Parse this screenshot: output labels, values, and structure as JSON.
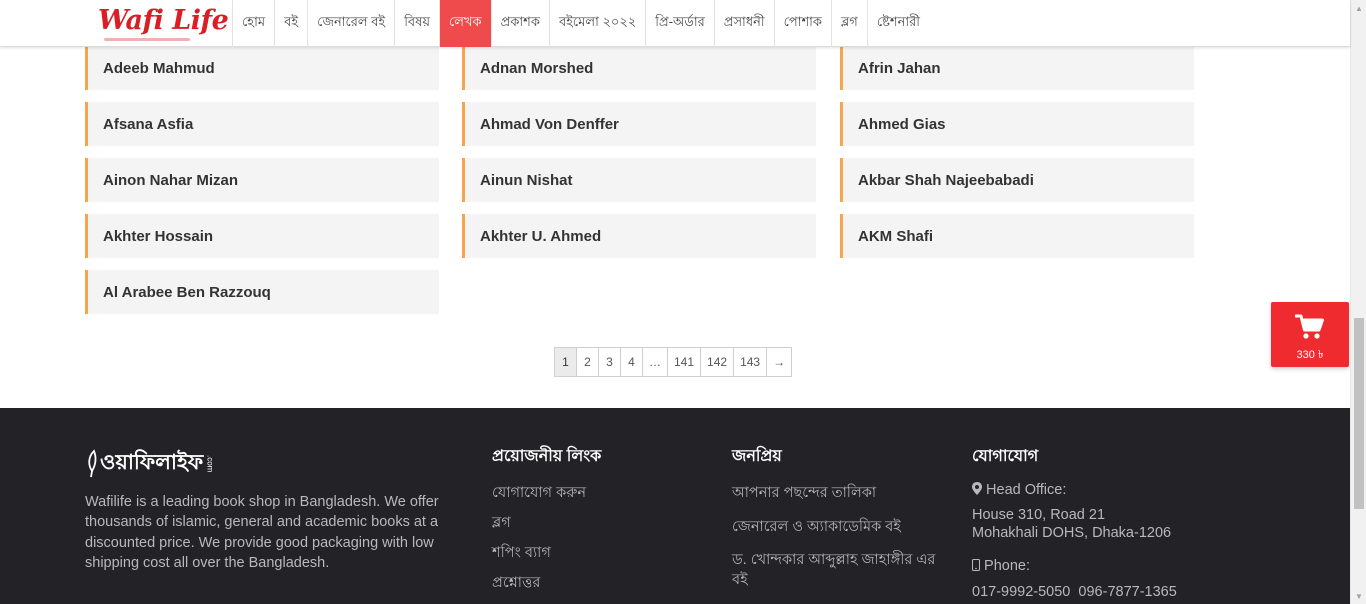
{
  "header": {
    "logo": "Wafi Life",
    "nav": [
      {
        "label": "হোম"
      },
      {
        "label": "বই"
      },
      {
        "label": "জেনারেল বই"
      },
      {
        "label": "বিষয়"
      },
      {
        "label": "লেখক",
        "active": true
      },
      {
        "label": "প্রকাশক"
      },
      {
        "label": "বইমেলা ২০২২"
      },
      {
        "label": "প্রি-অর্ডার"
      },
      {
        "label": "প্রসাধনী"
      },
      {
        "label": "পোশাক"
      },
      {
        "label": "ব্লগ"
      },
      {
        "label": "ষ্টেশনারী"
      }
    ]
  },
  "authors": [
    "Adeeb Mahmud",
    "Adnan Morshed",
    "Afrin Jahan",
    "Afsana Asfia",
    "Ahmad Von Denffer",
    "Ahmed Gias",
    "Ainon Nahar Mizan",
    "Ainun Nishat",
    "Akbar Shah Najeebabadi",
    "Akhter Hossain",
    "Akhter U. Ahmed",
    "AKM Shafi",
    "Al Arabee Ben Razzouq"
  ],
  "pagination": {
    "pages": [
      "1",
      "2",
      "3",
      "4",
      "…",
      "141",
      "142",
      "143",
      "→"
    ],
    "current": "1"
  },
  "cart": {
    "icon": "cart-icon",
    "amount": "330 ৳"
  },
  "footer": {
    "logo": "ওয়াফিলাইফ",
    "logo_suffix": ".com",
    "description": "Wafilife is a leading book shop in Bangladesh. We offer thousands of islamic, general and academic books at a discounted price. We provide good packaging with low shipping cost all over the Bangladesh.",
    "links_title": "প্রয়োজনীয় লিংক",
    "links": [
      "যোগাযোগ করুন",
      "ব্লগ",
      "শপিং ব্যাগ",
      "প্রশ্নোত্তর"
    ],
    "popular_title": "জনপ্রিয়",
    "popular": [
      "আপনার পছন্দের তালিকা",
      "জেনারেল ও অ্যাকাডেমিক বই",
      "ড. খোন্দকার আব্দুল্লাহ জাহাঙ্গীর এর বই"
    ],
    "contact_title": "যোগাযোগ",
    "head_office_label": "Head Office:",
    "address_line1": "House 310, Road 21",
    "address_line2": "Mohakhali DOHS, Dhaka-1206",
    "phone_label": "Phone:",
    "phones": "017-9992-5050  096-7877-1365"
  }
}
